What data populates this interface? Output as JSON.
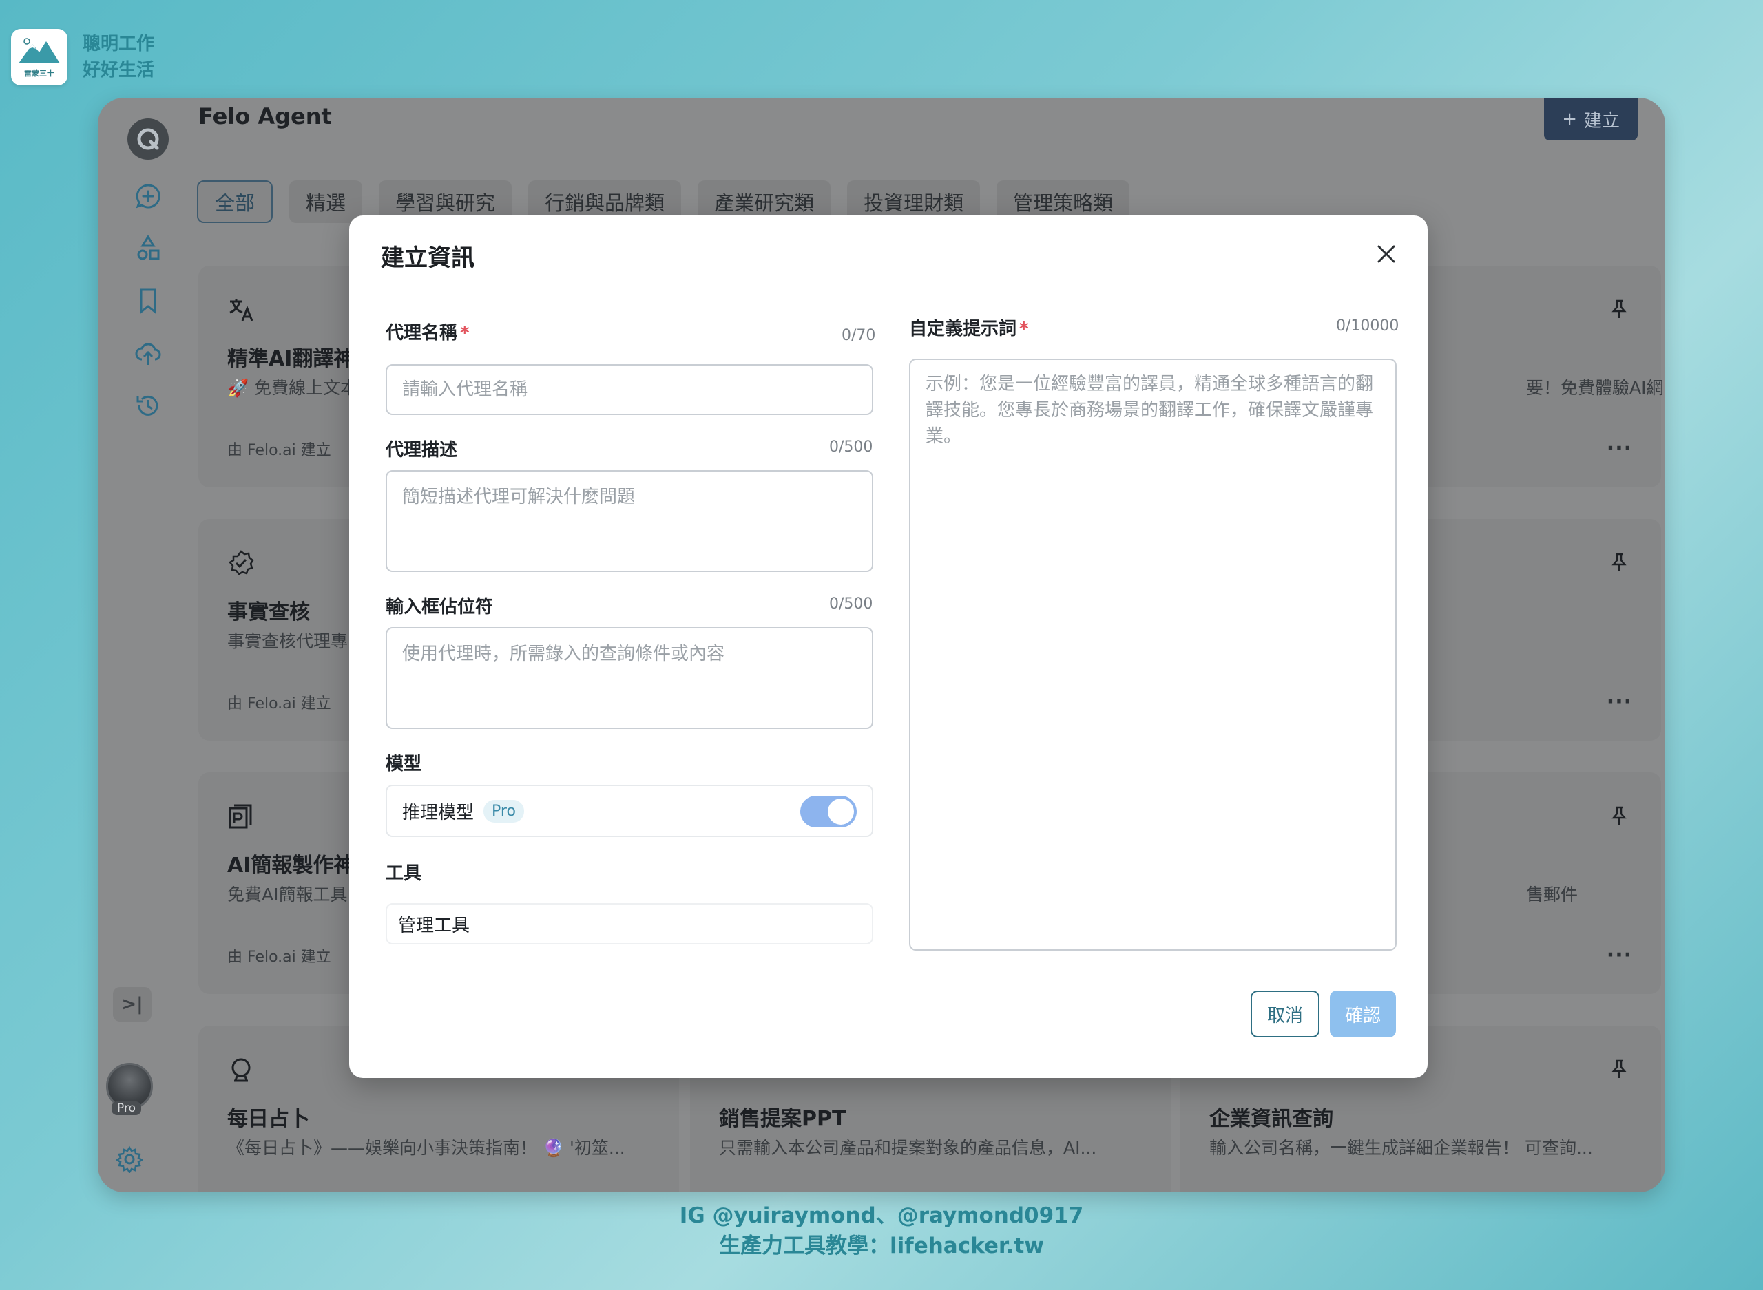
{
  "brand": {
    "line1": "聰明工作",
    "line2": "好好生活",
    "logo_text": "雷蒙三十"
  },
  "app": {
    "title": "Felo Agent",
    "create_label": "建立",
    "tabs": [
      {
        "label": "全部",
        "active": true
      },
      {
        "label": "精選"
      },
      {
        "label": "學習與研究"
      },
      {
        "label": "行銷與品牌類"
      },
      {
        "label": "產業研究類"
      },
      {
        "label": "投資理財類"
      },
      {
        "label": "管理策略類"
      }
    ],
    "avatar_badge": "Pro",
    "cards": [
      {
        "title": "精準AI翻譯神",
        "desc": "🚀 免費線上文本",
        "by": "由 Felo.ai 建立"
      },
      {
        "title": "事實查核",
        "desc": "事實查核代理專",
        "by": "由 Felo.ai 建立"
      },
      {
        "title": "AI簡報製作神",
        "desc": "免費AI簡報工具",
        "by": "由 Felo.ai 建立"
      },
      {
        "title": "每日占卜",
        "desc": "《每日占卜》——娛樂向小事決策指南！ 🔮 '初筮...",
        "by": ""
      },
      {
        "title": "銷售提案PPT",
        "desc": "只需輸入本公司產品和提案對象的產品信息，AI...",
        "by": ""
      },
      {
        "title": "企業資訊查詢",
        "desc": "輸入公司名稱，一鍵生成詳細企業報告！ 可查詢...",
        "by": ""
      }
    ],
    "right_snippets": {
      "row1": "要！免費體驗AI網頁...",
      "row3": "售郵件"
    },
    "more_label": "···"
  },
  "modal": {
    "title": "建立資訊",
    "name": {
      "label": "代理名稱",
      "counter": "0/70",
      "placeholder": "請輸入代理名稱",
      "value": ""
    },
    "desc": {
      "label": "代理描述",
      "counter": "0/500",
      "placeholder": "簡短描述代理可解決什麼問題"
    },
    "placeholder_field": {
      "label": "輸入框佔位符",
      "counter": "0/500",
      "placeholder": "使用代理時，所需錄入的查詢條件或內容"
    },
    "model": {
      "label": "模型",
      "name": "推理模型",
      "badge": "Pro",
      "enabled": true
    },
    "tools": {
      "label": "工具",
      "value": "管理工具"
    },
    "prompt": {
      "label": "自定義提示詞",
      "counter": "0/10000",
      "placeholder": "示例：您是一位經驗豐富的譯員，精通全球多種語言的翻譯技能。您專長於商務場景的翻譯工作，確保譯文嚴謹專業。"
    },
    "cancel_label": "取消",
    "confirm_label": "確認"
  },
  "footer": {
    "line1": "IG @yuiraymond、@raymond0917",
    "line2": "生產力工具教學：lifehacker.tw"
  },
  "colors": {
    "accent": "#2e6f83",
    "confirm": "#8ec0ee",
    "required": "#e2525c"
  }
}
